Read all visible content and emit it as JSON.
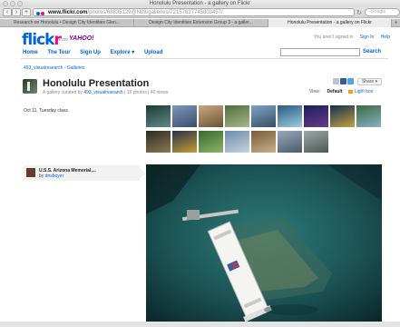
{
  "browser": {
    "window_title": "Honolulu Presentation - a gallery on Flickr",
    "url_host": "www.flickr.com",
    "url_path": "/photos/68835129@N08/galleries/72157627745803457/",
    "search_placeholder": "Google",
    "tabs": [
      {
        "label": "Research on Honolulu • Design City Identities Glen...",
        "active": false
      },
      {
        "label": "Design City Identities Extension Group 3 - a galler...",
        "active": false
      },
      {
        "label": "Honolulu Presentation - a gallery on Flickr",
        "active": true
      }
    ]
  },
  "flickr": {
    "logo_main": "flick",
    "logo_r": "r",
    "logo_from": "from",
    "logo_yahoo": "YAHOO!",
    "nav": [
      "Home",
      "The Tour",
      "Sign Up",
      "Explore ▾",
      "Upload"
    ],
    "signed_text": "You aren't signed in",
    "sign_in": "Sign In",
    "help": "Help",
    "search_button": "Search"
  },
  "gallery": {
    "breadcrumb_user": "493_visualresearch",
    "breadcrumb_sep": "›",
    "breadcrumb_section": "Galleries",
    "title": "Honolulu Presentation",
    "subtitle_prefix": "A gallery curated by",
    "curator": "493_visualresearch",
    "subtitle_suffix": "| 16 photos | 40 views",
    "share_label": "Share ▾",
    "view_label": "View:",
    "view_default": "Default",
    "view_lightbox": "Light box",
    "description": "Oct 11, Tuesday class",
    "thumbnails": [
      {
        "colors": [
          "#1e3a36",
          "#5f8a84"
        ]
      },
      {
        "colors": [
          "#7d96b8",
          "#3c4e6e"
        ]
      },
      {
        "colors": [
          "#c9a77c",
          "#6b5538"
        ]
      },
      {
        "colors": [
          "#4f6e3c",
          "#a8b78a"
        ]
      },
      {
        "colors": [
          "#7aa4c8",
          "#3b4f60"
        ]
      },
      {
        "colors": [
          "#2a5a7a",
          "#9ccbe4"
        ]
      },
      {
        "colors": [
          "#1a1f5a",
          "#6a3a8a"
        ]
      },
      {
        "colors": [
          "#103050",
          "#c4a040"
        ]
      },
      {
        "colors": [
          "#3a6a3a",
          "#8ab0c8"
        ]
      },
      {
        "colors": [
          "#2c2c24",
          "#8a7a50"
        ]
      },
      {
        "colors": [
          "#2b2e48",
          "#c0a030"
        ]
      },
      {
        "colors": [
          "#3c6a2c",
          "#8ab46c"
        ]
      },
      {
        "colors": [
          "#6a8cac",
          "#c8d4dc"
        ]
      },
      {
        "colors": [
          "#7a5c3a",
          "#c8b08a"
        ]
      },
      {
        "colors": [
          "#9aaabc",
          "#4a5a68"
        ]
      },
      {
        "colors": [
          "#9ca8a8",
          "#4c5850"
        ]
      }
    ],
    "current_photo": {
      "title": "U.S.S. Arizona Memorial,...",
      "by_prefix": "by",
      "author": "dnsboyer"
    }
  }
}
